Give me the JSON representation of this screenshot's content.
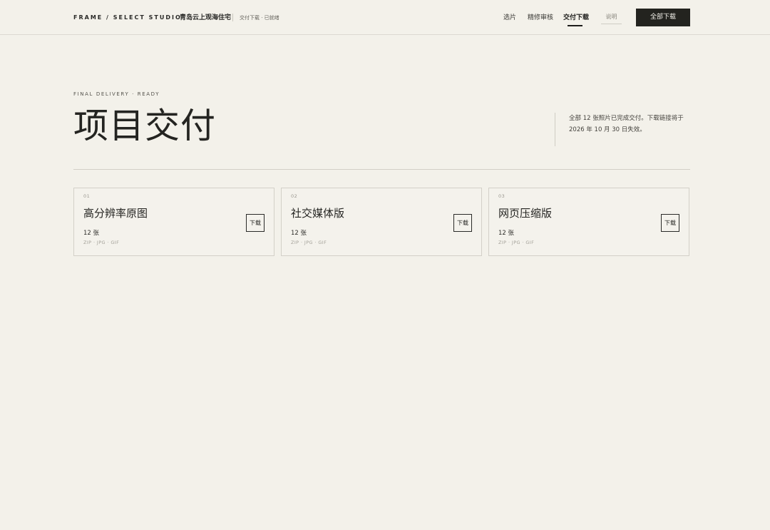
{
  "header": {
    "brand": "FRAME / SELECT STUDIO",
    "project_name": "青岛云上观海住宅",
    "status": "交付下载 · 已就绪",
    "nav": [
      {
        "label": "选片"
      },
      {
        "label": "精修审核"
      },
      {
        "label": "交付下载"
      }
    ],
    "help_label": "说明",
    "download_all_label": "全部下载"
  },
  "hero": {
    "eyebrow": "FINAL DELIVERY · READY",
    "title": "项目交付",
    "note_line1": "全部 12 张照片已完成交付。下载链接将于",
    "note_line2": "2026 年 10 月 30 日失效。"
  },
  "packages": [
    {
      "num": "01",
      "title": "高分辨率原图",
      "count": "12 张",
      "formats": "ZIP · JPG · GIF",
      "button": "下载"
    },
    {
      "num": "02",
      "title": "社交媒体版",
      "count": "12 张",
      "formats": "ZIP · JPG · GIF",
      "button": "下载"
    },
    {
      "num": "03",
      "title": "网页压缩版",
      "count": "12 张",
      "formats": "ZIP · JPG · GIF",
      "button": "下载"
    }
  ],
  "colors": {
    "background": "#f3f1ea",
    "primary": "#23231f",
    "border": "#d3d0c8"
  }
}
